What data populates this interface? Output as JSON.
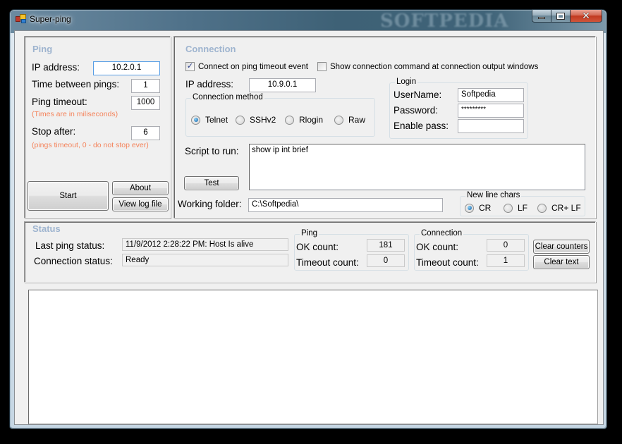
{
  "window": {
    "title": "Super-ping",
    "watermark": "SOFTPEDIA",
    "controls": {
      "minimize": "minimize",
      "maximize": "maximize",
      "close": "close"
    }
  },
  "ping": {
    "title": "Ping",
    "ip_label": "IP address:",
    "ip_value": "10.2.0.1",
    "interval_label": "Time between pings:",
    "interval_value": "1",
    "timeout_label": "Ping timeout:",
    "timeout_value": "1000",
    "timeout_hint": "(Times are in miliseconds)",
    "stop_label": "Stop after:",
    "stop_value": "6",
    "stop_hint": "(pings timeout, 0 - do not stop ever)",
    "start_button": "Start",
    "about_button": "About",
    "log_button": "View log file"
  },
  "connection": {
    "title": "Connection",
    "connect_on_timeout": {
      "label": "Connect on ping timeout event",
      "checked": true
    },
    "show_command": {
      "label": "Show connection command at connection output windows",
      "checked": false
    },
    "ip_label": "IP address:",
    "ip_value": "10.9.0.1",
    "method_group": "Connection method",
    "methods": [
      {
        "label": "Telnet",
        "selected": true
      },
      {
        "label": "SSHv2",
        "selected": false
      },
      {
        "label": "Rlogin",
        "selected": false
      },
      {
        "label": "Raw",
        "selected": false
      }
    ],
    "login_group": "Login",
    "username_label": "UserName:",
    "username_value": "Softpedia",
    "password_label": "Password:",
    "password_value": "*********",
    "enable_label": "Enable pass:",
    "enable_value": "",
    "script_label": "Script to run:",
    "script_value": "show ip int brief",
    "test_button": "Test",
    "folder_label": "Working folder:",
    "folder_value": "C:\\Softpedia\\",
    "newline_group": "New line chars",
    "newline_options": [
      {
        "label": "CR",
        "selected": true
      },
      {
        "label": "LF",
        "selected": false
      },
      {
        "label": "CR+ LF",
        "selected": false
      }
    ]
  },
  "status": {
    "title": "Status",
    "last_ping_label": "Last ping status:",
    "last_ping_value": "11/9/2012 2:28:22 PM: Host Is alive",
    "conn_status_label": "Connection status:",
    "conn_status_value": "Ready",
    "ping_group": "Ping",
    "ping_ok_label": "OK count:",
    "ping_ok_value": "181",
    "ping_timeout_label": "Timeout count:",
    "ping_timeout_value": "0",
    "conn_group": "Connection",
    "conn_ok_label": "OK count:",
    "conn_ok_value": "0",
    "conn_timeout_label": "Timeout count:",
    "conn_timeout_value": "1",
    "clear_counters_button": "Clear counters",
    "clear_text_button": "Clear text"
  },
  "output": {
    "text": ""
  }
}
